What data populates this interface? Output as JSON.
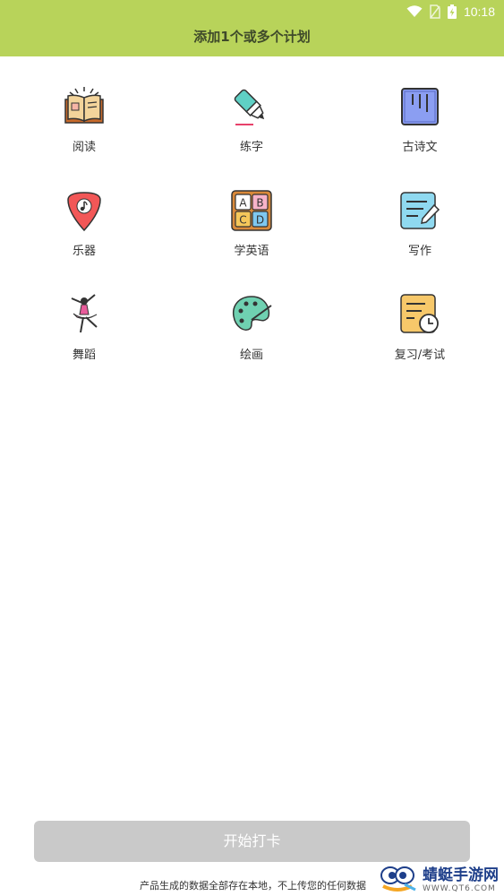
{
  "status": {
    "time": "10:18"
  },
  "header": {
    "title": "添加1个或多个计划"
  },
  "plans": [
    {
      "label": "阅读",
      "icon": "book-icon"
    },
    {
      "label": "练字",
      "icon": "marker-pen-icon"
    },
    {
      "label": "古诗文",
      "icon": "scroll-icon"
    },
    {
      "label": "乐器",
      "icon": "guitar-pick-icon"
    },
    {
      "label": "学英语",
      "icon": "abcd-blocks-icon"
    },
    {
      "label": "写作",
      "icon": "notepad-pen-icon"
    },
    {
      "label": "舞蹈",
      "icon": "ballet-dancer-icon"
    },
    {
      "label": "绘画",
      "icon": "paint-palette-icon"
    },
    {
      "label": "复习/考试",
      "icon": "document-clock-icon"
    }
  ],
  "start_button": {
    "label": "开始打卡"
  },
  "footer": {
    "note": "产品生成的数据全部存在本地，不上传您的任何数据"
  },
  "watermark": {
    "title": "蜻蜓手游网",
    "subtitle": "WWW.QT6.COM"
  },
  "colors": {
    "header": "#b8d35a",
    "button_disabled": "#c9c9c9"
  }
}
